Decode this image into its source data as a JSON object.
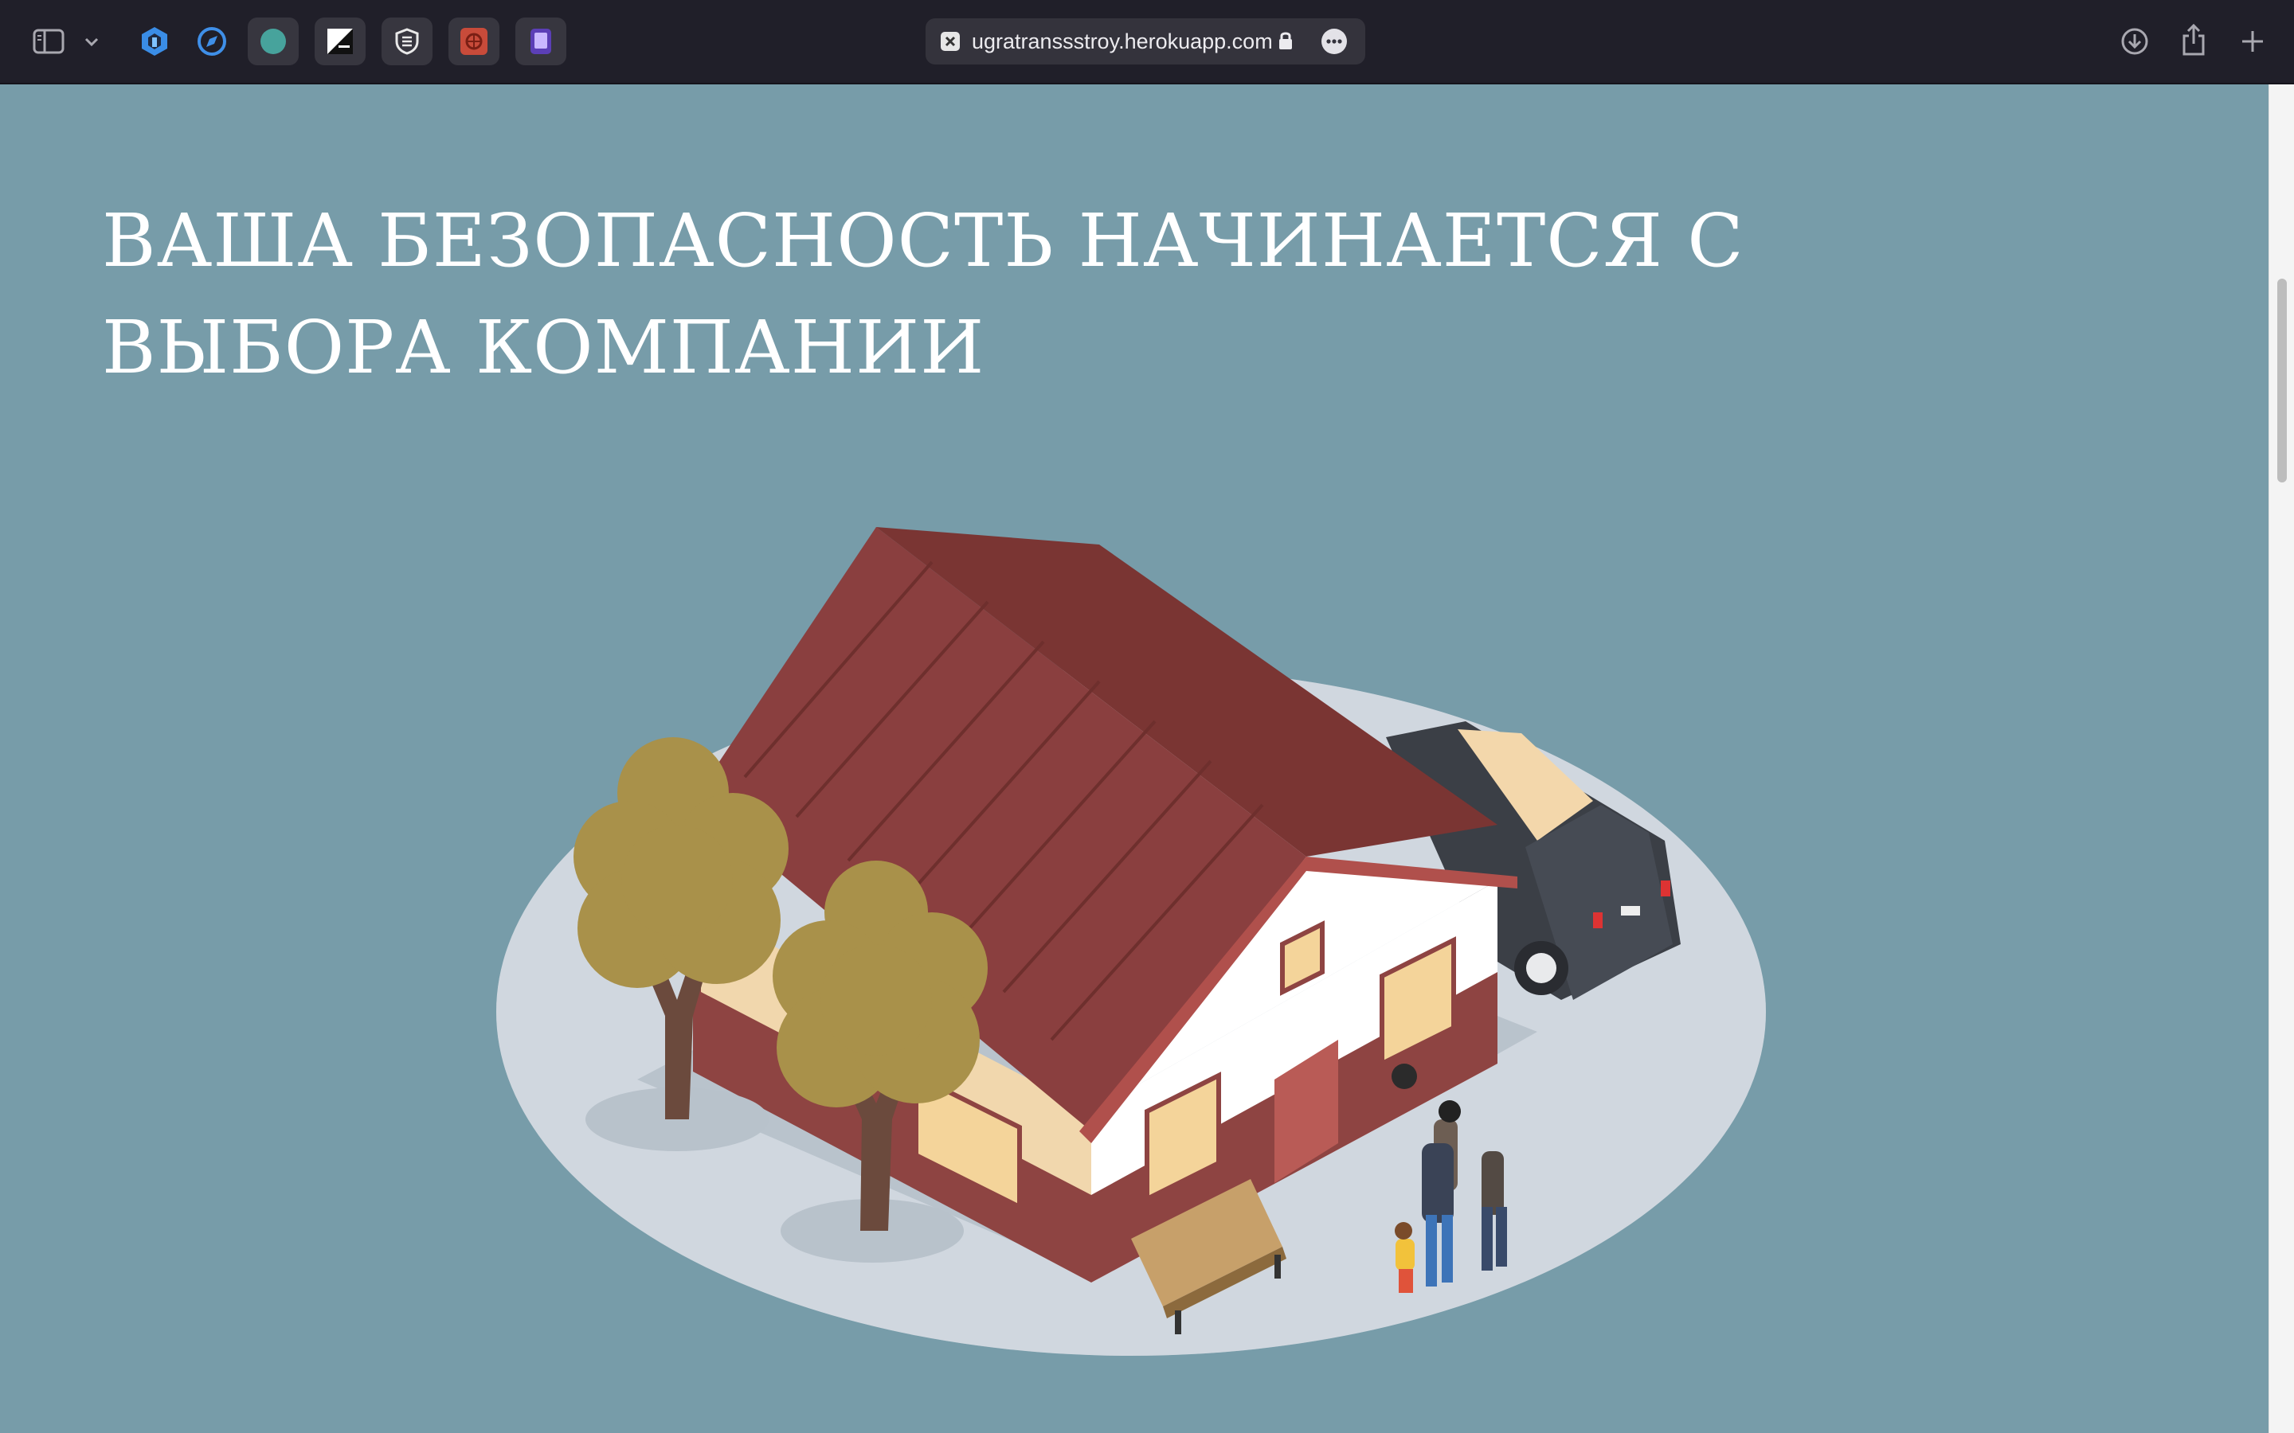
{
  "browser": {
    "url": "ugratranssstroy.herokuapp.com",
    "icons": {
      "sidebar": "sidebar-icon",
      "chevron": "chevron-down-icon",
      "favicon": "site-favicon-icon",
      "lock": "lock-icon",
      "more": "more-options-icon",
      "download": "download-icon",
      "share": "share-icon",
      "new_tab": "plus-icon"
    },
    "extensions": [
      "hexagon-extension-icon",
      "compass-extension-icon",
      "green-circle-extension-icon",
      "contrast-extension-icon",
      "shield-extension-icon",
      "red-extension-icon",
      "purple-extension-icon"
    ]
  },
  "hero": {
    "heading": "ВАША БЕЗОПАСНОСТЬ НАЧИНАЕТСЯ С ВЫБОРА КОМПАНИИ",
    "illustration": "house-illustration"
  },
  "colors": {
    "page_bg": "#779ca9",
    "toolbar_bg": "#201f29",
    "roof": "#8a3f3f",
    "wall": "#ffffff",
    "tree": "#a9914a"
  }
}
